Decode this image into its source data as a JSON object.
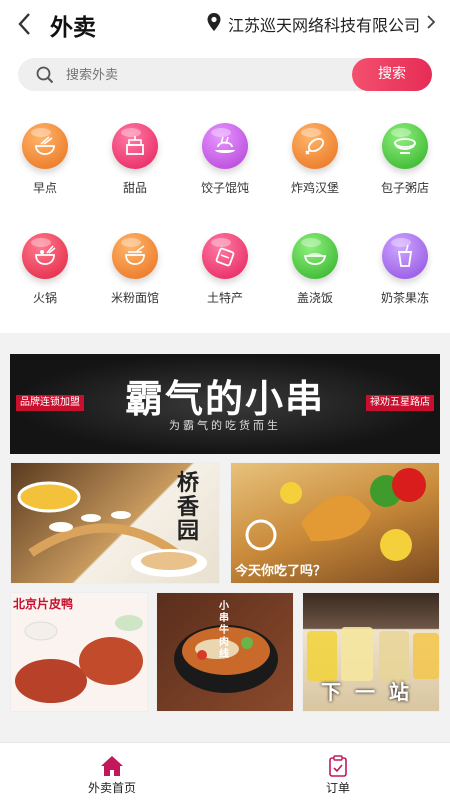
{
  "header": {
    "title": "外卖",
    "location": "江苏巡天网络科技有限公司"
  },
  "search": {
    "placeholder": "搜索外卖",
    "button": "搜索"
  },
  "categories": [
    {
      "label": "早点",
      "icon": "breakfast-icon",
      "color": "#f08a33"
    },
    {
      "label": "甜品",
      "icon": "cake-icon",
      "color": "#f03c77"
    },
    {
      "label": "饺子馄饨",
      "icon": "dumpling-icon",
      "color": "#c451e0"
    },
    {
      "label": "炸鸡汉堡",
      "icon": "fried-chicken-icon",
      "color": "#f08a33"
    },
    {
      "label": "包子粥店",
      "icon": "porridge-icon",
      "color": "#45c437"
    },
    {
      "label": "火锅",
      "icon": "hotpot-icon",
      "color": "#f03c5c"
    },
    {
      "label": "米粉面馆",
      "icon": "noodle-icon",
      "color": "#f08a33"
    },
    {
      "label": "土特产",
      "icon": "specialty-icon",
      "color": "#f03c77"
    },
    {
      "label": "盖浇饭",
      "icon": "rice-bowl-icon",
      "color": "#45c437"
    },
    {
      "label": "奶茶果冻",
      "icon": "milk-tea-icon",
      "color": "#a567e8"
    }
  ],
  "banner": {
    "left_tag": "品牌连锁加盟",
    "title": "霸气的小串",
    "subtitle": "为霸气的吃货而生",
    "right_tag": "禄劝五星路店"
  },
  "shops": [
    {
      "caption": "桥香园",
      "kind": "bridge-noodle"
    },
    {
      "caption": "今天你吃了吗？",
      "kind": "fried-chicken"
    },
    {
      "caption": "北京片皮鸭",
      "kind": "roast-duck"
    },
    {
      "caption": "小串牛肉线",
      "kind": "noodle-bowl"
    },
    {
      "caption": "下一站",
      "kind": "milk-tea"
    }
  ],
  "nav": [
    {
      "label": "外卖首页",
      "icon": "home-icon",
      "active": true
    },
    {
      "label": "订单",
      "icon": "order-icon",
      "active": false
    }
  ],
  "colors": {
    "accent": "#e62c55",
    "active_nav": "#c2185b"
  }
}
